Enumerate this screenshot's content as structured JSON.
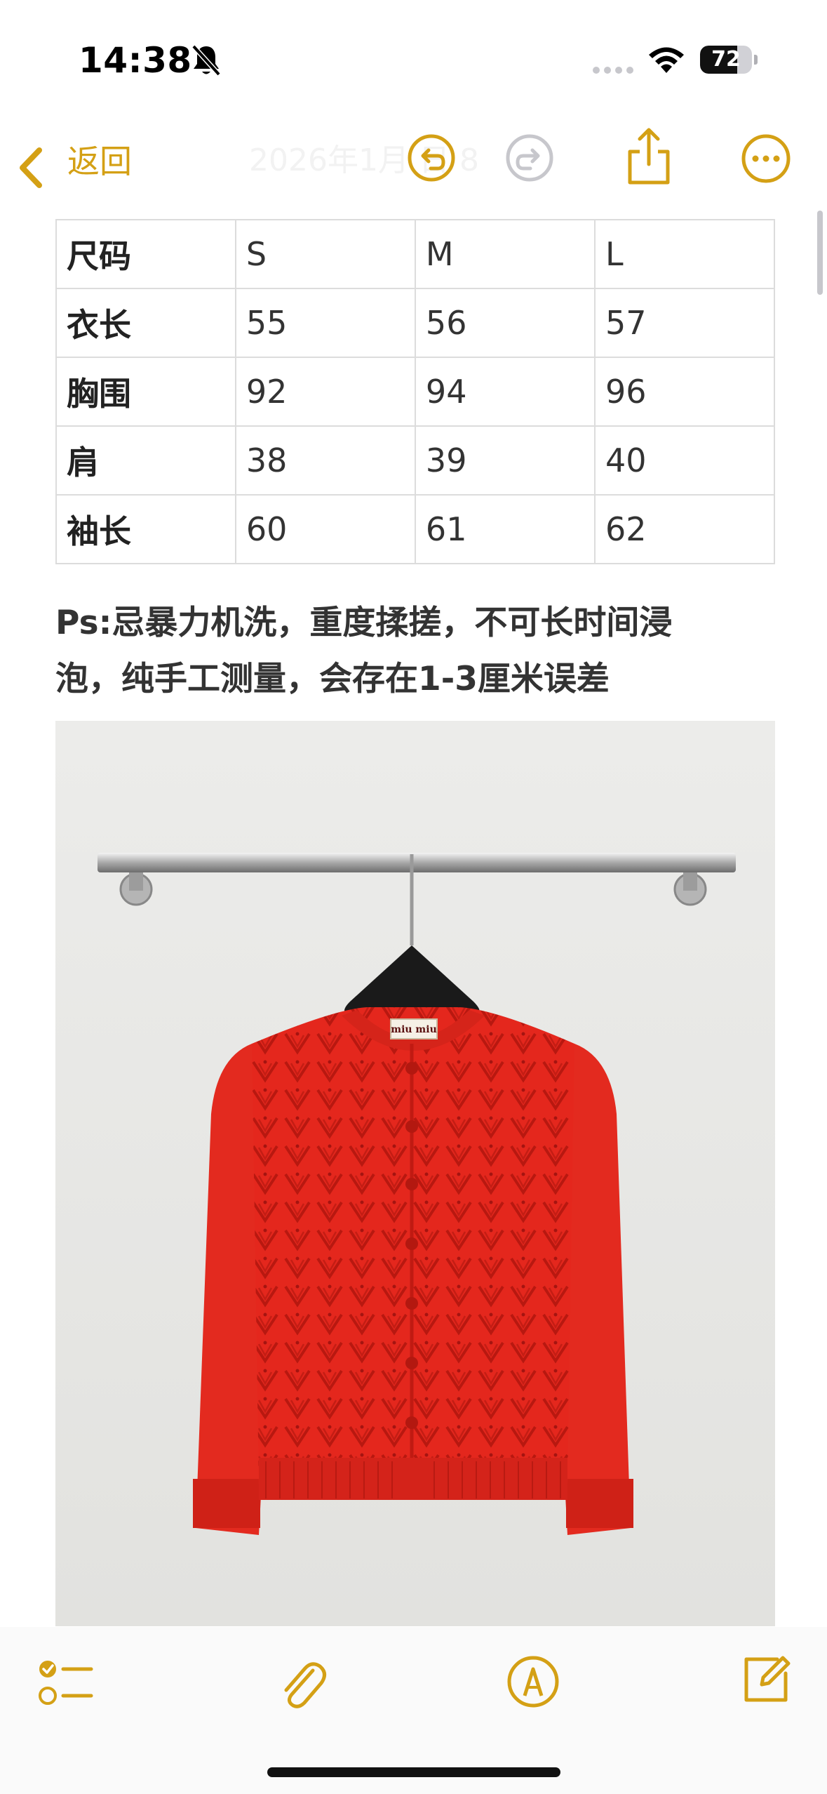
{
  "status_bar": {
    "time": "14:38",
    "battery_level": "72",
    "battery_fraction": 0.72,
    "icons": [
      "bell-slash-icon",
      "cellular-signal-icon",
      "wifi-icon",
      "battery-icon"
    ]
  },
  "nav": {
    "back_label": "返回",
    "faded_title": "2026年1月     日 8",
    "icons": [
      "chevron-left-icon",
      "undo-icon",
      "redo-icon",
      "share-icon",
      "more-icon"
    ],
    "accent_color": "#D4A015",
    "disabled_color": "#C7C7CC"
  },
  "size_table": {
    "rows": [
      {
        "label": "尺码",
        "s": "S",
        "m": "M",
        "l": "L"
      },
      {
        "label": "衣长",
        "s": "55",
        "m": "56",
        "l": "57"
      },
      {
        "label": "胸围",
        "s": "92",
        "m": "94",
        "l": "96"
      },
      {
        "label": "肩",
        "s": "38",
        "m": "39",
        "l": "40"
      },
      {
        "label": "袖长",
        "s": "60",
        "m": "61",
        "l": "62"
      }
    ]
  },
  "note": {
    "line1": "Ps:忌暴力机洗，重度揉搓，不可长时间浸",
    "line2": "泡，纯手工测量，会存在1-3厘米误差"
  },
  "photo": {
    "subject": "red-knit-cardigan-on-hanger",
    "label_text": "miu miu",
    "garment_color": "#E8281E",
    "wall_color": "#E9E9E7"
  },
  "toolbar": {
    "icons": [
      "checklist-icon",
      "paperclip-icon",
      "markup-pen-icon",
      "compose-icon"
    ]
  }
}
